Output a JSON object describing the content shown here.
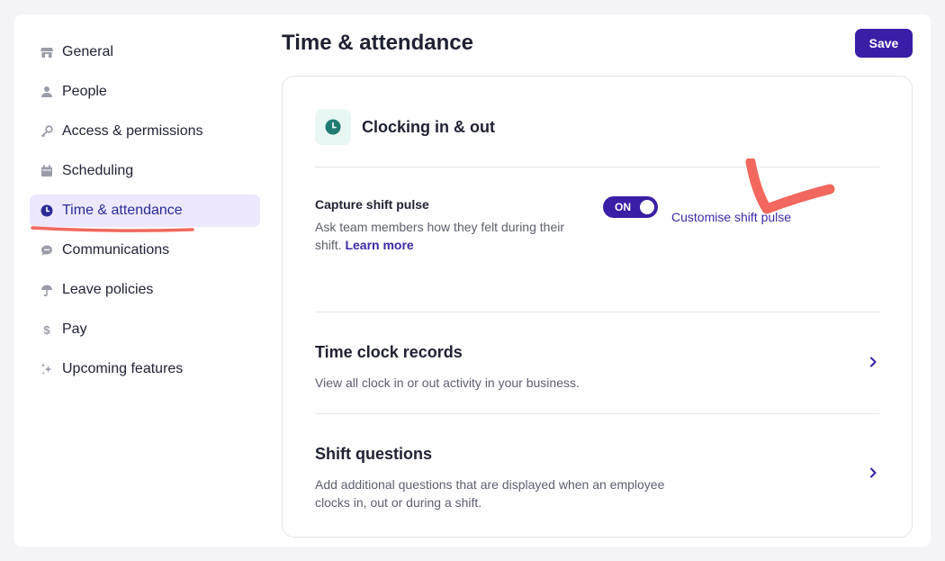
{
  "sidebar": {
    "items": [
      {
        "label": "General",
        "icon": "store-icon"
      },
      {
        "label": "People",
        "icon": "person-icon"
      },
      {
        "label": "Access & permissions",
        "icon": "key-icon"
      },
      {
        "label": "Scheduling",
        "icon": "calendar-icon"
      },
      {
        "label": "Time & attendance",
        "icon": "clock-icon",
        "active": true
      },
      {
        "label": "Communications",
        "icon": "chat-icon"
      },
      {
        "label": "Leave policies",
        "icon": "umbrella-icon"
      },
      {
        "label": "Pay",
        "icon": "dollar-icon"
      },
      {
        "label": "Upcoming features",
        "icon": "sparkle-icon"
      }
    ]
  },
  "header": {
    "title": "Time & attendance",
    "save_label": "Save"
  },
  "clocking": {
    "title": "Clocking in & out",
    "icon": "clock-icon",
    "shift_pulse": {
      "title": "Capture shift pulse",
      "description": "Ask team members how they felt during their shift.",
      "learn_more": "Learn more",
      "toggle_label": "ON",
      "customise_link": "Customise shift pulse"
    }
  },
  "time_clock_records": {
    "title": "Time clock records",
    "description": "View all clock in or out activity in your business."
  },
  "shift_questions": {
    "title": "Shift questions",
    "description": "Add additional questions that are displayed when an employee clocks in, out or during a shift."
  },
  "colors": {
    "accent": "#3b1ea6",
    "active_nav_bg": "#ede8fd",
    "clock_teal": "#1f7a72",
    "annotation_red": "#f2685e"
  }
}
